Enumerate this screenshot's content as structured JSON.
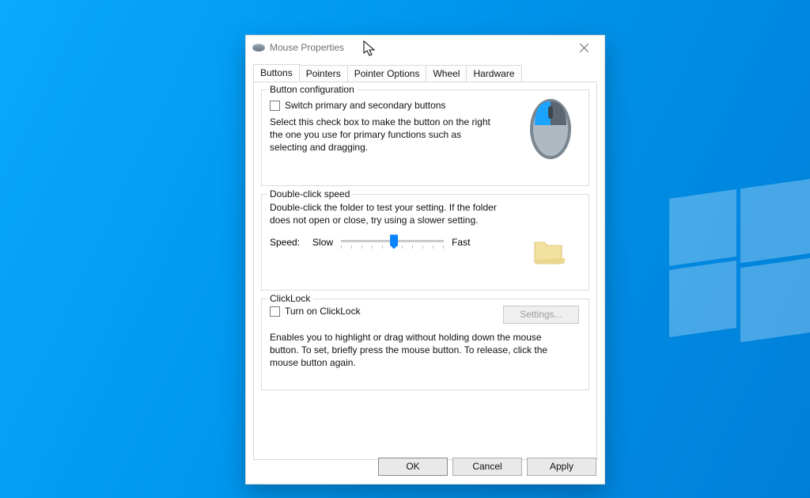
{
  "window": {
    "title": "Mouse Properties"
  },
  "tabs": {
    "buttons": "Buttons",
    "pointers": "Pointers",
    "pointer_options": "Pointer Options",
    "wheel": "Wheel",
    "hardware": "Hardware"
  },
  "group1": {
    "legend": "Button configuration",
    "checkbox": "Switch primary and secondary buttons",
    "desc": "Select this check box to make the button on the right the one you use for primary functions such as selecting and dragging."
  },
  "group2": {
    "legend": "Double-click speed",
    "desc": "Double-click the folder to test your setting. If the folder does not open or close, try using a slower setting.",
    "speed_label": "Speed:",
    "slow": "Slow",
    "fast": "Fast"
  },
  "group3": {
    "legend": "ClickLock",
    "checkbox": "Turn on ClickLock",
    "settings_btn": "Settings...",
    "desc": "Enables you to highlight or drag without holding down the mouse button. To set, briefly press the mouse button. To release, click the mouse button again."
  },
  "buttons": {
    "ok": "OK",
    "cancel": "Cancel",
    "apply": "Apply"
  },
  "slider": {
    "value": 5,
    "min": 0,
    "max": 10
  }
}
